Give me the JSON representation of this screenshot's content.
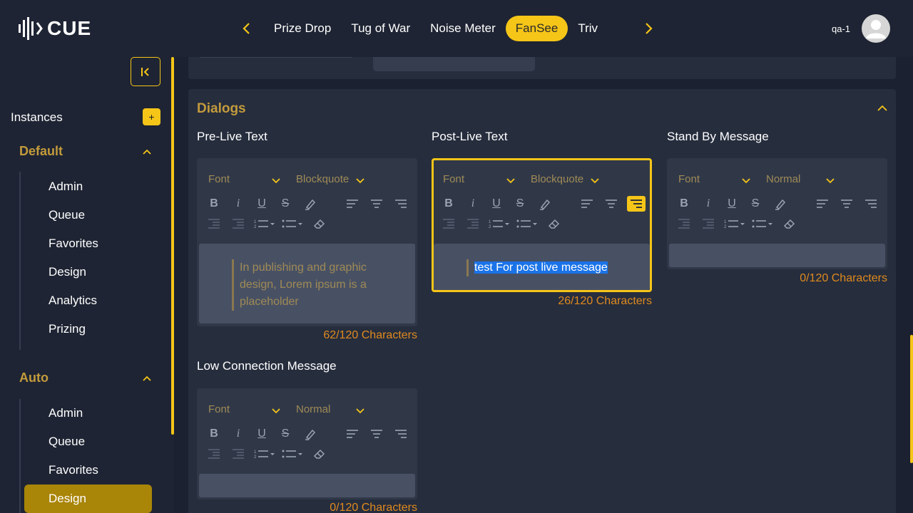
{
  "app": {
    "logo_text": "CUE"
  },
  "header": {
    "tabs": [
      {
        "label": "Prize Drop",
        "active": false
      },
      {
        "label": "Tug of War",
        "active": false
      },
      {
        "label": "Noise Meter",
        "active": false
      },
      {
        "label": "FanSee",
        "active": true
      },
      {
        "label": "Triv",
        "active": false
      }
    ],
    "user_name": "qa-1"
  },
  "sidebar": {
    "instances_label": "Instances",
    "add_label": "+",
    "groups": [
      {
        "title": "Default",
        "items": [
          "Admin",
          "Queue",
          "Favorites",
          "Design",
          "Analytics",
          "Prizing"
        ]
      },
      {
        "title": "Auto",
        "items": [
          "Admin",
          "Queue",
          "Favorites",
          "Design"
        ],
        "active_item": "Design"
      }
    ]
  },
  "dialogs": {
    "title": "Dialogs",
    "editors": [
      {
        "label": "Pre-Live Text",
        "font_select": "Font",
        "style_select": "Blockquote",
        "content": "In publishing and graphic design, Lorem ipsum is a placeholder",
        "counter": "62/120 Characters"
      },
      {
        "label": "Post-Live Text",
        "font_select": "Font",
        "style_select": "Blockquote",
        "content": "test For post live message",
        "counter": "26/120 Characters"
      },
      {
        "label": "Stand By Message",
        "font_select": "Font",
        "style_select": "Normal",
        "content": "",
        "counter": "0/120 Characters"
      },
      {
        "label": "Low Connection Message",
        "font_select": "Font",
        "style_select": "Normal",
        "content": "",
        "counter": "0/120 Characters"
      }
    ]
  },
  "colors": {
    "accent": "#f5c518",
    "section_title": "#c39b3c",
    "counter": "#e08a1e",
    "background": "#1e2433",
    "selection": "#1a73e8"
  },
  "icons": [
    "logo-icon",
    "chevron-left-icon",
    "chevron-right-icon",
    "user-icon",
    "collapse-sidebar-icon",
    "chevron-up-icon",
    "bold-icon",
    "italic-icon",
    "underline-icon",
    "strikethrough-icon",
    "highlight-icon",
    "align-left-icon",
    "align-center-icon",
    "align-right-icon",
    "outdent-icon",
    "indent-icon",
    "ordered-list-icon",
    "bullet-list-icon",
    "clear-format-icon"
  ]
}
